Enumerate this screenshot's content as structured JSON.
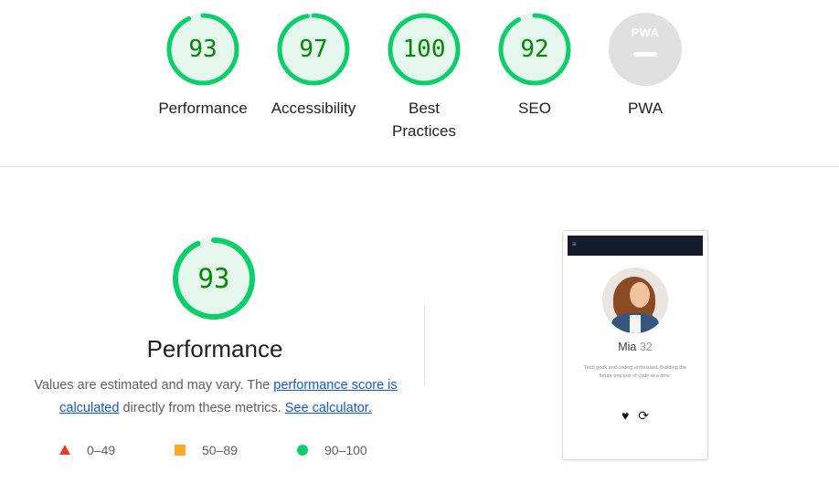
{
  "categories": [
    {
      "key": "performance",
      "score": "93",
      "label": "Performance",
      "color": "#0cce6b"
    },
    {
      "key": "accessibility",
      "score": "97",
      "label": "Accessibility",
      "color": "#0cce6b"
    },
    {
      "key": "best-practices",
      "score": "100",
      "label_line1": "Best",
      "label_line2": "Practices",
      "color": "#0cce6b"
    },
    {
      "key": "seo",
      "score": "92",
      "label": "SEO",
      "color": "#0cce6b"
    },
    {
      "key": "pwa",
      "badge": "PWA",
      "label": "PWA",
      "color": "#e0e0e0"
    }
  ],
  "performance": {
    "score": "93",
    "score_fraction": 0.93,
    "title": "Performance",
    "desc_prefix": "Values are estimated and may vary. The ",
    "desc_link1": "performance score is calculated",
    "desc_middle": " directly from these metrics. ",
    "desc_link2": "See calculator."
  },
  "legend": [
    {
      "shape": "triangle",
      "color": "#e53935",
      "range": "0–49"
    },
    {
      "shape": "square",
      "color": "#ffa726",
      "range": "50–89"
    },
    {
      "shape": "circle",
      "color": "#0cce6b",
      "range": "90–100"
    }
  ],
  "screenshot": {
    "menu_icon": "hamburger-icon",
    "name": "Mia",
    "age": "32",
    "bio": "Tech geek and coding enthusiast. Building the future one line of code at a time.",
    "like_icon": "heart-icon",
    "refresh_icon": "refresh-icon"
  },
  "colors": {
    "pass": "#0cce6b",
    "pass_text": "#008800",
    "pass_fill": "#e6f8ee",
    "link": "#1a55d0"
  }
}
